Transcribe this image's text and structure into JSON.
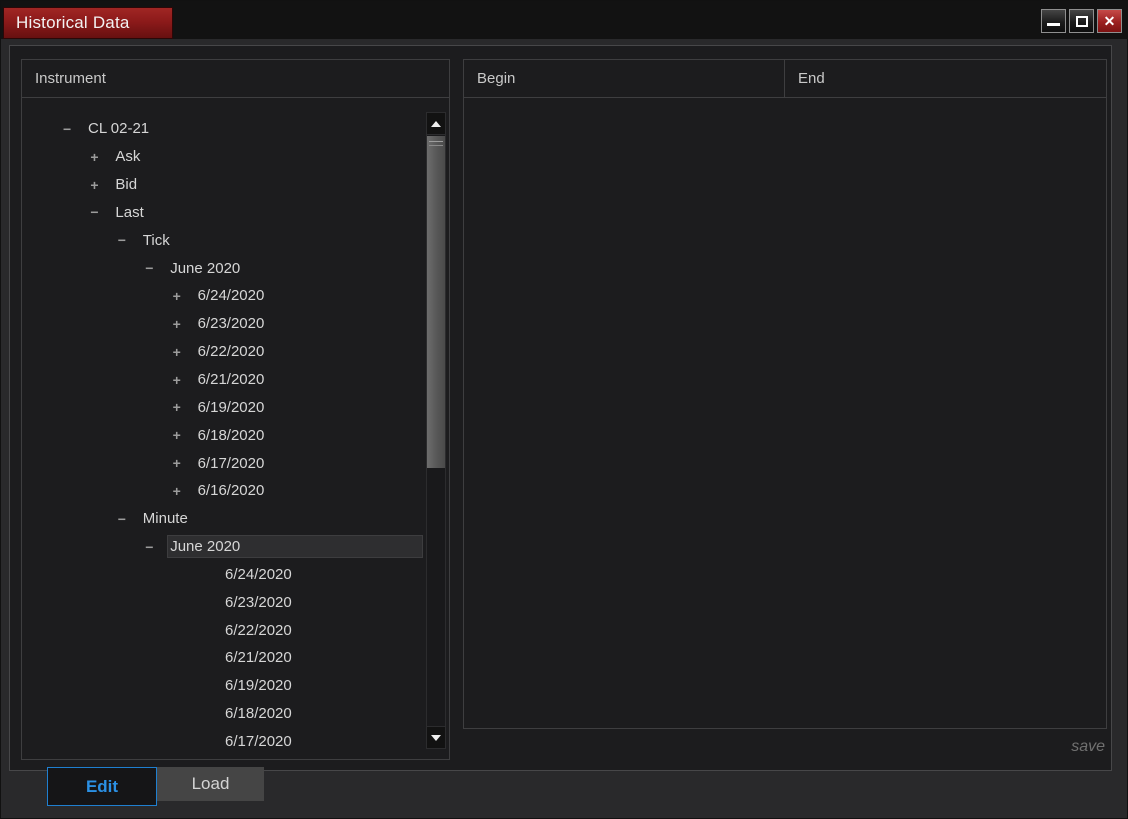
{
  "window": {
    "title": "Historical Data",
    "controls": [
      "minimize-icon",
      "maximize-icon",
      "close-icon"
    ]
  },
  "left_panel": {
    "header": "Instrument",
    "tree": [
      {
        "label": "CL 02-21",
        "level": 0,
        "expander": "minus",
        "selected": false
      },
      {
        "label": "Ask",
        "level": 1,
        "expander": "plus",
        "selected": false
      },
      {
        "label": "Bid",
        "level": 1,
        "expander": "plus",
        "selected": false
      },
      {
        "label": "Last",
        "level": 1,
        "expander": "minus",
        "selected": false
      },
      {
        "label": "Tick",
        "level": 2,
        "expander": "minus",
        "selected": false
      },
      {
        "label": "June 2020",
        "level": 3,
        "expander": "minus",
        "selected": false
      },
      {
        "label": "6/24/2020",
        "level": 4,
        "expander": "plus",
        "selected": false
      },
      {
        "label": "6/23/2020",
        "level": 4,
        "expander": "plus",
        "selected": false
      },
      {
        "label": "6/22/2020",
        "level": 4,
        "expander": "plus",
        "selected": false
      },
      {
        "label": "6/21/2020",
        "level": 4,
        "expander": "plus",
        "selected": false
      },
      {
        "label": "6/19/2020",
        "level": 4,
        "expander": "plus",
        "selected": false
      },
      {
        "label": "6/18/2020",
        "level": 4,
        "expander": "plus",
        "selected": false
      },
      {
        "label": "6/17/2020",
        "level": 4,
        "expander": "plus",
        "selected": false
      },
      {
        "label": "6/16/2020",
        "level": 4,
        "expander": "plus",
        "selected": false
      },
      {
        "label": "Minute",
        "level": 2,
        "expander": "minus",
        "selected": false
      },
      {
        "label": "June 2020",
        "level": 3,
        "expander": "minus",
        "selected": true
      },
      {
        "label": "6/24/2020",
        "level": 5,
        "expander": null,
        "selected": false
      },
      {
        "label": "6/23/2020",
        "level": 5,
        "expander": null,
        "selected": false
      },
      {
        "label": "6/22/2020",
        "level": 5,
        "expander": null,
        "selected": false
      },
      {
        "label": "6/21/2020",
        "level": 5,
        "expander": null,
        "selected": false
      },
      {
        "label": "6/19/2020",
        "level": 5,
        "expander": null,
        "selected": false
      },
      {
        "label": "6/18/2020",
        "level": 5,
        "expander": null,
        "selected": false
      },
      {
        "label": "6/17/2020",
        "level": 5,
        "expander": null,
        "selected": false
      }
    ]
  },
  "right_panel": {
    "columns": [
      "Begin",
      "End"
    ]
  },
  "footer": {
    "save_label": "save"
  },
  "tabs": [
    {
      "label": "Edit",
      "active": true
    },
    {
      "label": "Load",
      "active": false
    }
  ],
  "colors": {
    "title_red": "#8c1a1a",
    "close_red": "#9c2020",
    "accent_blue": "#2b90e4",
    "background": "#1c1c1e",
    "frame": "#29292b",
    "text": "#d6d6d6"
  }
}
